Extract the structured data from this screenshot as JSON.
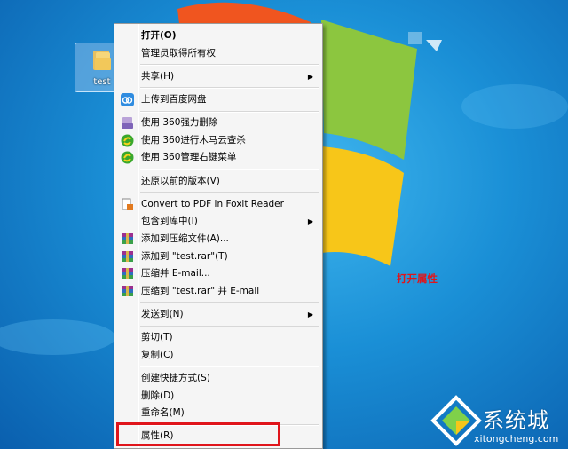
{
  "desktop": {
    "icon_label": "test"
  },
  "context_menu": {
    "groups": [
      [
        {
          "label": "打开(O)",
          "bold": true
        },
        {
          "label": "管理员取得所有权"
        }
      ],
      [
        {
          "label": "共享(H)",
          "submenu": true
        }
      ],
      [
        {
          "label": "上传到百度网盘",
          "icon": "baidu-cloud-icon"
        }
      ],
      [
        {
          "label": "使用 360强力删除",
          "icon": "shredder-360-icon"
        },
        {
          "label": "使用 360进行木马云查杀",
          "icon": "scan-360-icon"
        },
        {
          "label": "使用 360管理右键菜单",
          "icon": "manage-360-icon"
        }
      ],
      [
        {
          "label": "还原以前的版本(V)"
        }
      ],
      [
        {
          "label": "Convert to PDF in Foxit Reader",
          "icon": "foxit-pdf-icon"
        },
        {
          "label": "包含到库中(I)",
          "submenu": true
        },
        {
          "label": "添加到压缩文件(A)...",
          "icon": "winrar-icon"
        },
        {
          "label": "添加到 \"test.rar\"(T)",
          "icon": "winrar-icon"
        },
        {
          "label": "压缩并 E-mail...",
          "icon": "winrar-icon"
        },
        {
          "label": "压缩到 \"test.rar\" 并 E-mail",
          "icon": "winrar-icon"
        }
      ],
      [
        {
          "label": "发送到(N)",
          "submenu": true
        }
      ],
      [
        {
          "label": "剪切(T)"
        },
        {
          "label": "复制(C)"
        }
      ],
      [
        {
          "label": "创建快捷方式(S)"
        },
        {
          "label": "删除(D)"
        },
        {
          "label": "重命名(M)"
        }
      ],
      [
        {
          "label": "属性(R)",
          "highlighted": true
        }
      ]
    ]
  },
  "annotation": "打开属性",
  "watermark": {
    "name": "系统城",
    "url": "xitongcheng.com"
  },
  "colors": {
    "highlight": "#e0151b",
    "menu_bg": "#f5f5f5"
  }
}
